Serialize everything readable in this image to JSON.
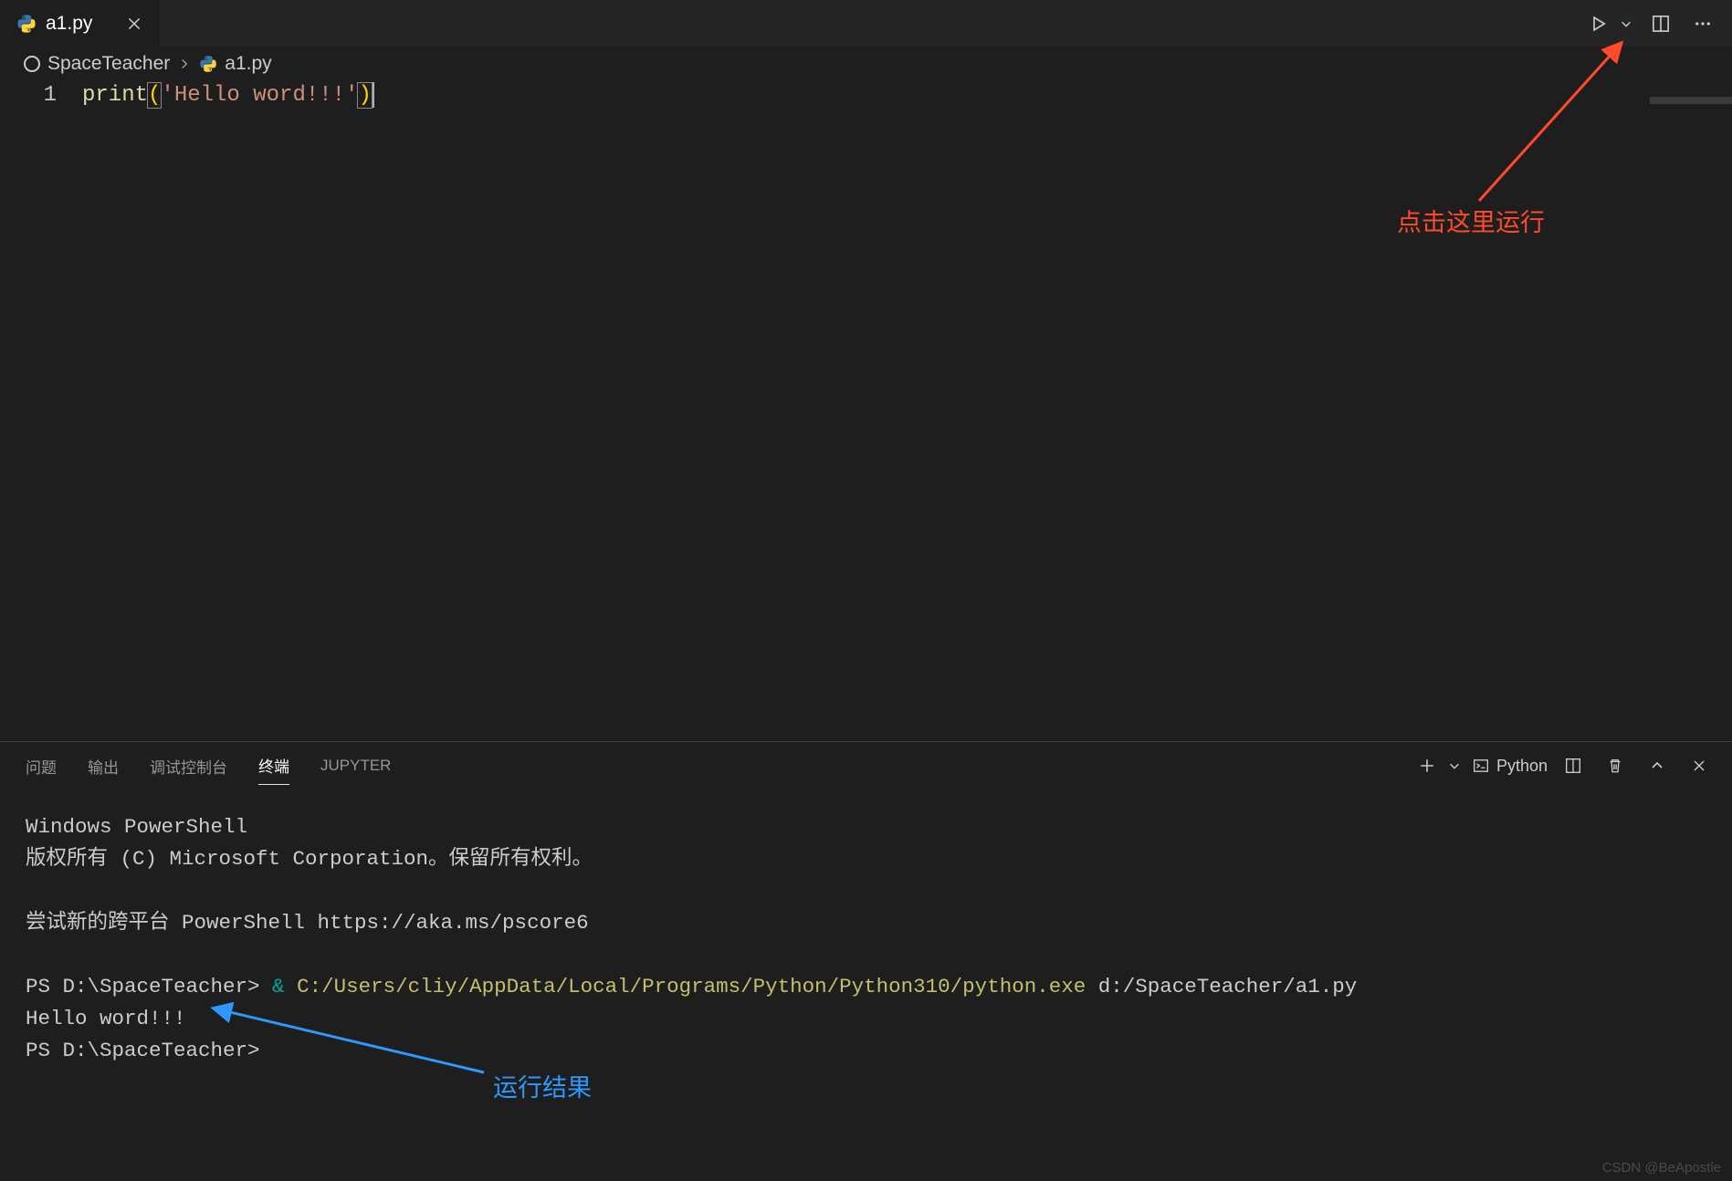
{
  "tab": {
    "filename": "a1.py"
  },
  "breadcrumbs": {
    "root": "SpaceTeacher",
    "file": "a1.py"
  },
  "editor": {
    "line_number": "1",
    "code": {
      "fn": "print",
      "lp": "(",
      "str": "'Hello word!!!'",
      "rp": ")"
    }
  },
  "panel": {
    "tabs": {
      "problems": "问题",
      "output": "输出",
      "debug": "调试控制台",
      "terminal": "终端",
      "jupyter": "JUPYTER"
    },
    "shell_name": "Python",
    "terminal_lines": {
      "l1": "Windows PowerShell",
      "l2": "版权所有 (C) Microsoft Corporation。保留所有权利。",
      "l3": "",
      "l4": "尝试新的跨平台 PowerShell https://aka.ms/pscore6",
      "l5": "",
      "l6_prompt": "PS D:\\SpaceTeacher> ",
      "l6_amp": "&",
      "l6_exe": " C:/Users/cliy/AppData/Local/Programs/Python/Python310/python.exe",
      "l6_arg": " d:/SpaceTeacher/a1.py",
      "l7": "Hello word!!!",
      "l8": "PS D:\\SpaceTeacher>"
    }
  },
  "annotations": {
    "run_hint": "点击这里运行",
    "result_hint": "运行结果"
  },
  "watermark": "CSDN @BeApostle"
}
